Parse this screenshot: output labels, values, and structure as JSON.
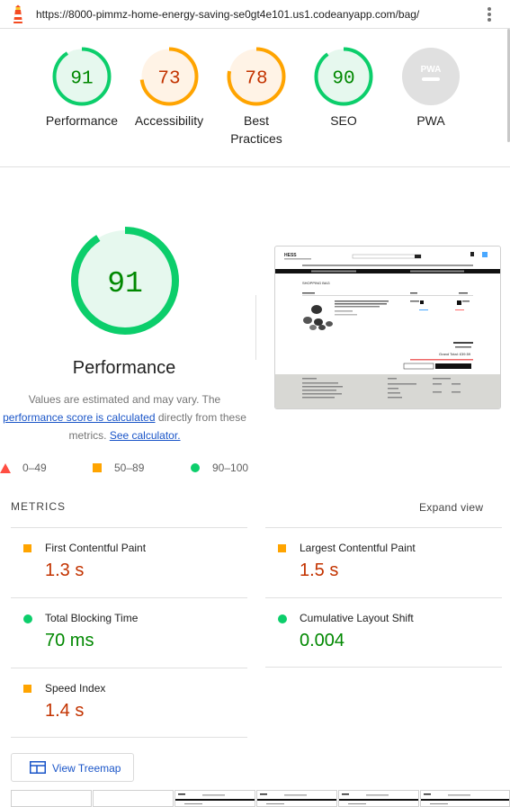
{
  "browser": {
    "url": "https://8000-pimmz-home-energy-saving-se0gt4e101.us1.codeanyapp.com/bag/"
  },
  "summary_scores": [
    {
      "label": "Performance",
      "score": "91",
      "value": 91,
      "color": "#0cce6b",
      "fill": "#e6f8ee",
      "text_color": "#008800"
    },
    {
      "label": "Accessibility",
      "score": "73",
      "value": 73,
      "color": "#ffa400",
      "fill": "#fff3e6",
      "text_color": "#c33300"
    },
    {
      "label": "Best Practices",
      "score": "78",
      "value": 78,
      "color": "#ffa400",
      "fill": "#fff3e6",
      "text_color": "#c33300"
    },
    {
      "label": "SEO",
      "score": "90",
      "value": 90,
      "color": "#0cce6b",
      "fill": "#e6f8ee",
      "text_color": "#008800"
    },
    {
      "label": "PWA",
      "score": "PWA",
      "value": 0,
      "color": "#e0e0e0",
      "fill": "#e0e0e0",
      "text_color": "#9e9e9e"
    }
  ],
  "performance": {
    "score": "91",
    "value": 91,
    "title": "Performance",
    "desc_prefix": "Values are estimated and may vary. The",
    "desc_link": "performance score is calculated",
    "desc_middle": "directly from these metrics.",
    "calc_link": "See calculator."
  },
  "legend": [
    {
      "range": "0–49",
      "icon": "triangle-fail-icon",
      "color": "#ff4e42"
    },
    {
      "range": "50–89",
      "icon": "square-average-icon",
      "color": "#ffa400"
    },
    {
      "range": "90–100",
      "icon": "circle-pass-icon",
      "color": "#0cce6b"
    }
  ],
  "metrics_section": {
    "heading": "METRICS",
    "expand_label": "Expand view"
  },
  "metrics": [
    {
      "label": "First Contentful Paint",
      "value": "1.3 s",
      "status": "average",
      "color": "#c33300",
      "icon_color": "#ffa400"
    },
    {
      "label": "Largest Contentful Paint",
      "value": "1.5 s",
      "status": "average",
      "color": "#c33300",
      "icon_color": "#ffa400"
    },
    {
      "label": "Total Blocking Time",
      "value": "70 ms",
      "status": "pass",
      "color": "#008800",
      "icon_color": "#0cce6b"
    },
    {
      "label": "Cumulative Layout Shift",
      "value": "0.004",
      "status": "pass",
      "color": "#008800",
      "icon_color": "#0cce6b"
    },
    {
      "label": "Speed Index",
      "value": "1.4 s",
      "status": "average",
      "color": "#c33300",
      "icon_color": "#ffa400"
    }
  ],
  "treemap_button": {
    "label": "View Treemap"
  },
  "page_thumbnail": {
    "brand": "HESS",
    "heading": "SHOPPING BAG",
    "total": "Grand Total: £39.59"
  }
}
